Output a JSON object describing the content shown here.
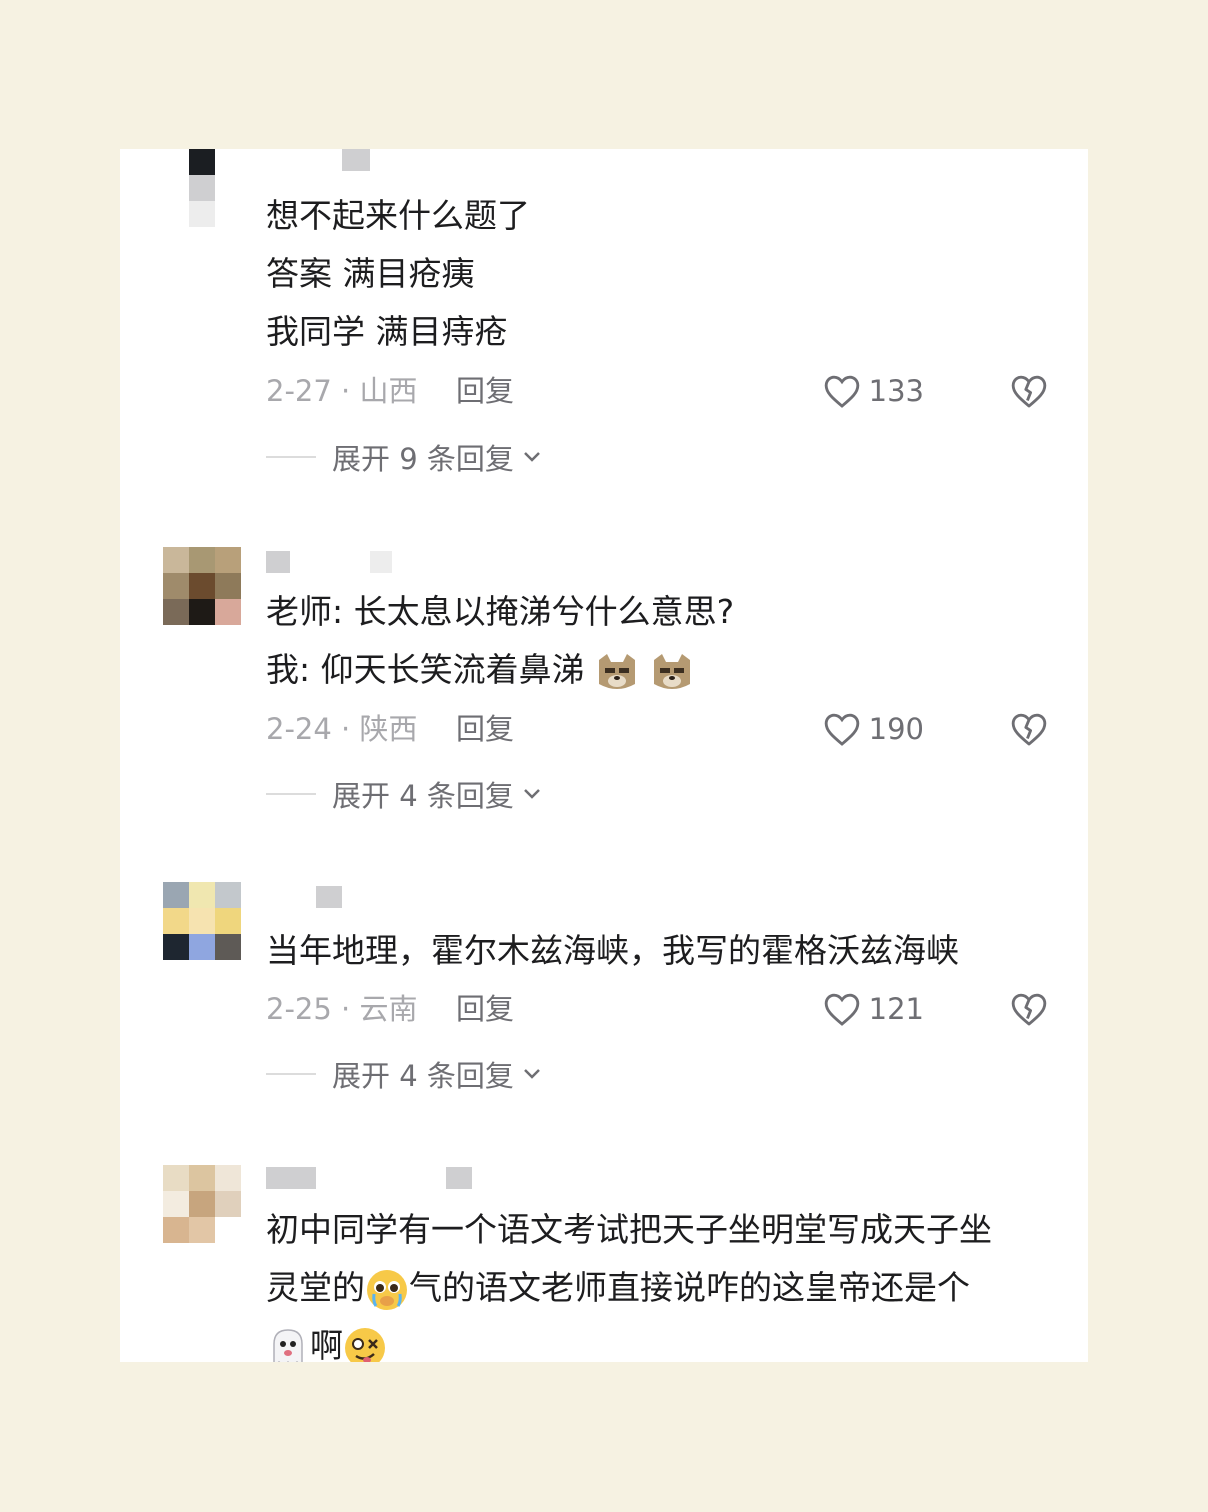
{
  "comments": [
    {
      "lines": [
        "想不起来什么题了",
        "答案 满目疮痍",
        "我同学 满目痔疮"
      ],
      "date_region": "2-27 · 山西",
      "reply_label": "回复",
      "likes": "133",
      "expand_label": "展开 9 条回复"
    },
    {
      "lines": [
        "老师: 长太息以掩涕兮什么意思?",
        "我:  仰天长笑流着鼻涕"
      ],
      "date_region": "2-24 · 陕西",
      "reply_label": "回复",
      "likes": "190",
      "expand_label": "展开 4 条回复"
    },
    {
      "lines": [
        "当年地理，霍尔木兹海峡，我写的霍格沃兹海峡"
      ],
      "date_region": "2-25 · 云南",
      "reply_label": "回复",
      "likes": "121",
      "expand_label": "展开 4 条回复"
    },
    {
      "lines": [
        "初中同学有一个语文考试把天子坐明堂写成天子坐",
        "灵堂的",
        "气的语文老师直接说咋的这皇帝还是个",
        "啊"
      ],
      "date_region": "",
      "reply_label": "",
      "likes": "",
      "expand_label": ""
    }
  ],
  "icons": {
    "like": "heart-outline-icon",
    "dislike": "broken-heart-icon",
    "expand": "chevron-down-icon",
    "emoji_2": "doge-face-emoji",
    "emoji_4a": "pleading-face-emoji",
    "emoji_4b": "ghost-emoji",
    "emoji_4c": "woozy-face-emoji"
  },
  "colors": {
    "background": "#f6f2e2",
    "card": "#ffffff",
    "text": "#1d1d1f",
    "meta": "#a8a8ac"
  }
}
